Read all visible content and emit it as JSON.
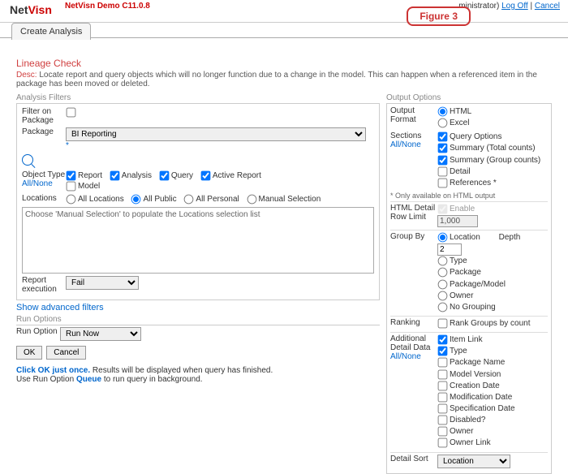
{
  "header": {
    "logo1": "Net",
    "logo2": "Visn",
    "demo": "NetVisn Demo C11.0.8",
    "admin": "ministrator)",
    "logoff": "Log Off",
    "cancel": "Cancel",
    "figure": "Figure 3",
    "tab": "Create Analysis"
  },
  "title": "Lineage Check",
  "descLabel": "Desc:",
  "desc": "Locate report and query objects which will no longer function due to a change in the model. This can happen when a referenced item in the package has been moved or deleted.",
  "filters": {
    "title": "Analysis Filters",
    "filterOn": "Filter on Package",
    "pkgLabel": "Package",
    "pkgValue": "BI Reporting",
    "star": "*",
    "objType": "Object Type",
    "allNone": "All/None",
    "types": [
      "Report",
      "Analysis",
      "Query",
      "Active Report",
      "Model"
    ],
    "locLabel": "Locations",
    "locs": [
      "All Locations",
      "All Public",
      "All Personal",
      "Manual Selection"
    ],
    "locHint": "Choose 'Manual Selection' to populate the Locations selection list",
    "repExec": "Report execution",
    "repExecVal": "Fail",
    "adv": "Show advanced filters"
  },
  "run": {
    "title": "Run Options",
    "label": "Run Option",
    "value": "Run Now",
    "ok": "OK",
    "cancel": "Cancel"
  },
  "note": {
    "bold": "Click OK just once.",
    "l1": " Results will be displayed when query has finished.",
    "l2a": "Use Run Option ",
    "l2b": "Queue",
    "l2c": " to run query in background."
  },
  "out": {
    "title": "Output Options",
    "fmt": "Output Format",
    "fmts": [
      "HTML",
      "Excel"
    ],
    "sec": "Sections",
    "secs": [
      "Query Options",
      "Summary (Total counts)",
      "Summary (Group counts)",
      "Detail",
      "References *"
    ],
    "secNote": "* Only available on HTML output",
    "htmlDetail": "HTML Detail Row Limit",
    "enable": "Enable",
    "limit": "1,000",
    "grp": "Group By",
    "grps": [
      "Location",
      "Type",
      "Package",
      "Package/Model",
      "Owner",
      "No Grouping"
    ],
    "depth": "Depth",
    "depthVal": "2",
    "rank": "Ranking",
    "rankOpt": "Rank Groups by count",
    "add": "Additional Detail Data",
    "adds": [
      "Item Link",
      "Type",
      "Package Name",
      "Model Version",
      "Creation Date",
      "Modification Date",
      "Specification Date",
      "Disabled?",
      "Owner",
      "Owner Link"
    ],
    "dsort": "Detail Sort",
    "dsortVal": "Location"
  }
}
